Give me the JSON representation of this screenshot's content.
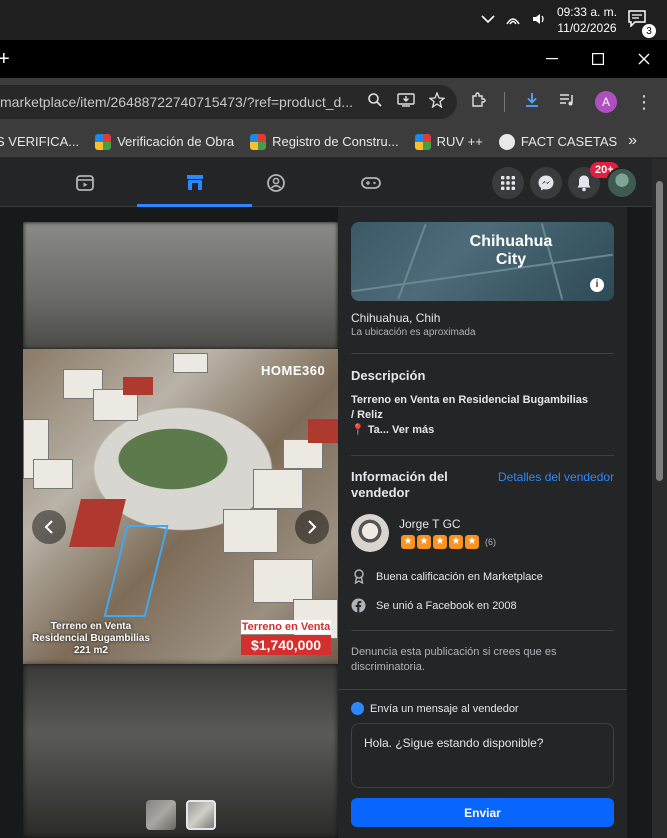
{
  "taskbar": {
    "time": "09:33 a. m.",
    "date": "11/02/2026",
    "notification_count": "3"
  },
  "browser": {
    "new_tab": "+",
    "url": "marketplace/item/26488722740715473/?ref=product_d...",
    "profile_initial": "A",
    "bookmarks": [
      {
        "label": "S VERIFICA..."
      },
      {
        "label": "Verificación de Obra"
      },
      {
        "label": "Registro de Constru..."
      },
      {
        "label": "RUV ++"
      },
      {
        "label": "FACT CASETAS"
      }
    ],
    "bookmarks_more": "»"
  },
  "fb_nav": {
    "notification_badge": "20+"
  },
  "photo": {
    "watermark": "HOME360",
    "caption_line1": "Terreno en Venta",
    "caption_line2": "Residencial Bugambilias",
    "caption_line3": "221 m2",
    "sale_label": "Terreno en Venta",
    "sale_price": "$1,740,000"
  },
  "listing": {
    "map_city_line1": "Chihuahua",
    "map_city_line2": "City",
    "location": "Chihuahua, Chih",
    "location_note": "La ubicación es aproximada",
    "description_title": "Descripción",
    "description_line1": "Terreno en Venta en Residencial Bugambilias",
    "description_line2": "/ Reliz",
    "description_line3": "Ta...",
    "see_more": "Ver más",
    "seller_info_title_line1": "Información del",
    "seller_info_title_line2": "vendedor",
    "seller_details_link": "Detalles del vendedor",
    "seller_name": "Jorge T GC",
    "rating_count": "(6)",
    "rating_stars": 5,
    "badge_marketplace": "Buena calificación en Marketplace",
    "joined": "Se unió a Facebook en 2008",
    "report_text": "Denuncia esta publicación si crees que es discriminatoria."
  },
  "message": {
    "header": "Envía un mensaje al vendedor",
    "input_value": "Hola. ¿Sigue estando disponible?",
    "send_label": "Enviar"
  },
  "colors": {
    "accent": "#2d88ff",
    "send_button": "#0866ff",
    "notif_badge": "#e41e3f",
    "star": "#f7931e",
    "sale_red": "#d32f2f"
  }
}
